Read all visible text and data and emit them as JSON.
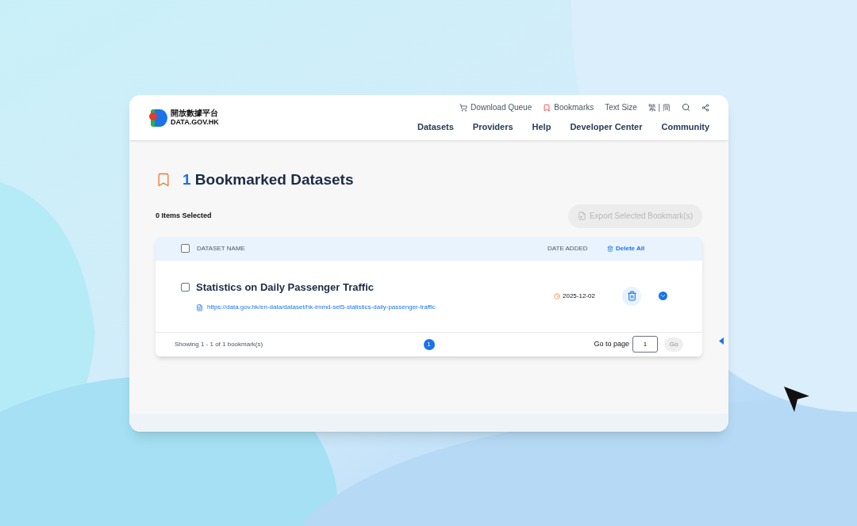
{
  "header": {
    "logo": {
      "name_zh": "開放數據平台",
      "name_en": "DATA.GOV.HK"
    },
    "utility_links": [
      {
        "kind": "download",
        "label": "Download Queue"
      },
      {
        "kind": "bookmarks",
        "label": "Bookmarks"
      },
      {
        "kind": "text",
        "label": "Text Size"
      },
      {
        "kind": "lang",
        "label": "繁 | 簡"
      }
    ],
    "nav": [
      "Datasets",
      "Providers",
      "Help",
      "Developer Center",
      "Community"
    ]
  },
  "page": {
    "count": "1",
    "title": "Bookmarked Datasets",
    "selected_count": "0 Items Selected",
    "export_button": {
      "label": "Export Selected Bookmark(s)",
      "disabled": true
    }
  },
  "table": {
    "columns": [
      "DATASET NAME",
      "DATE ADDED"
    ],
    "delete_all": "Delete All",
    "header_checked": false,
    "rows": [
      {
        "checked": false,
        "name": "Statistics on Daily Passenger Traffic",
        "url": "https://data.gov.hk/en-data/dataset/hk-immd-set5-statistics-daily-passenger-traffic",
        "date": "2025-12-02",
        "expanded": false
      }
    ]
  },
  "footer": {
    "showing": "Showing 1 - 1 of 1 bookmark(s)",
    "pages": [
      {
        "label": "1",
        "selected": true
      }
    ],
    "goto_label": "Go to page",
    "goto_value": "1",
    "go_button": {
      "label": "Go",
      "disabled": true
    }
  }
}
